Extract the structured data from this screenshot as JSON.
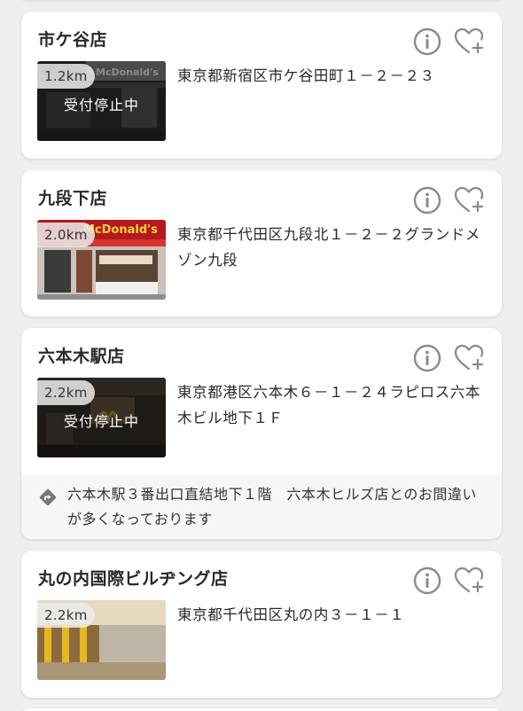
{
  "colors": {
    "background": "#efefef",
    "card": "#ffffff",
    "text": "#292929",
    "icon": "#8a8a8a",
    "notice_bg": "#f6f6f6",
    "distance_badge_bg": "#ebebeb"
  },
  "stores": [
    {
      "name": "市ケ谷店",
      "distance": "1.2km",
      "status": "受付停止中",
      "address": "東京都新宿区市ケ谷田町１－２－２３",
      "info_icon": "info-icon",
      "favorite_icon": "heart-plus-icon"
    },
    {
      "name": "九段下店",
      "distance": "2.0km",
      "status": "",
      "sign_text": "McDonald's",
      "address": "東京都千代田区九段北１－２－２グランドメゾン九段",
      "info_icon": "info-icon",
      "favorite_icon": "heart-plus-icon"
    },
    {
      "name": "六本木駅店",
      "distance": "2.2km",
      "status": "受付停止中",
      "address": "東京都港区六本木６－１－２４ラピロス六本木ビル地下１Ｆ",
      "info_icon": "info-icon",
      "favorite_icon": "heart-plus-icon",
      "notice_icon": "directions-icon",
      "notice": "六本木駅３番出口直結地下１階　六本木ヒルズ店とのお間違いが多くなっております"
    },
    {
      "name": "丸の内国際ビルヂング店",
      "distance": "2.2km",
      "status": "",
      "address": "東京都千代田区丸の内３－１－１",
      "info_icon": "info-icon",
      "favorite_icon": "heart-plus-icon"
    }
  ]
}
